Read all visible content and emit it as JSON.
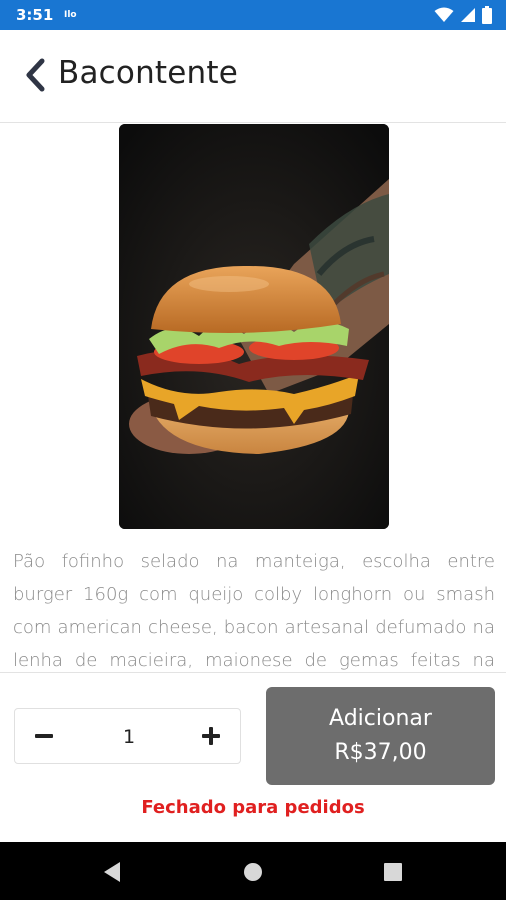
{
  "status_bar": {
    "time": "3:51",
    "notification": "Ilo",
    "icons": [
      "wifi-icon",
      "signal-icon",
      "battery-icon"
    ],
    "color": "#1976d2"
  },
  "header": {
    "title": "Bacontente"
  },
  "product": {
    "image_icon": "burger-photo",
    "description": "Pão fofinho selado na manteiga, escolha entre burger 160g com queijo colby longhorn ou smash com american cheese, bacon artesanal defumado na lenha de macieira, maionese de gemas feitas na casa"
  },
  "order": {
    "quantity": "1",
    "add_label": "Adicionar",
    "add_price": "R$37,00",
    "button_color": "#6d6d6d",
    "closed_notice": "Fechado para pedidos",
    "closed_color": "#e02020"
  }
}
